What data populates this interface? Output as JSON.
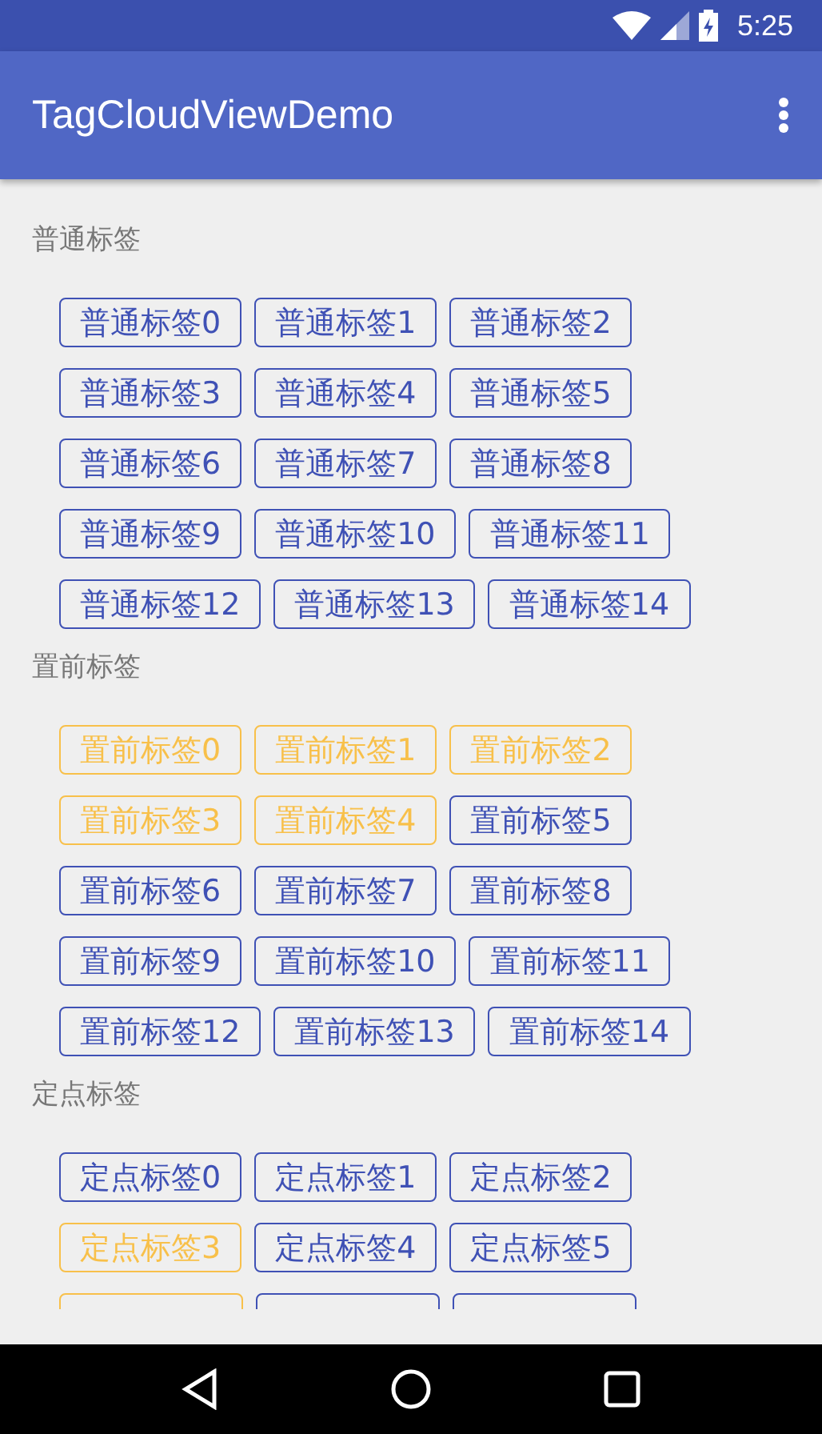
{
  "status_bar": {
    "time": "5:25"
  },
  "app_bar": {
    "title": "TagCloudViewDemo"
  },
  "sections": [
    {
      "title": "普通标签",
      "tags": [
        {
          "label": "普通标签0",
          "selected": false
        },
        {
          "label": "普通标签1",
          "selected": false
        },
        {
          "label": "普通标签2",
          "selected": false
        },
        {
          "label": "普通标签3",
          "selected": false
        },
        {
          "label": "普通标签4",
          "selected": false
        },
        {
          "label": "普通标签5",
          "selected": false
        },
        {
          "label": "普通标签6",
          "selected": false
        },
        {
          "label": "普通标签7",
          "selected": false
        },
        {
          "label": "普通标签8",
          "selected": false
        },
        {
          "label": "普通标签9",
          "selected": false
        },
        {
          "label": "普通标签10",
          "selected": false
        },
        {
          "label": "普通标签11",
          "selected": false
        },
        {
          "label": "普通标签12",
          "selected": false
        },
        {
          "label": "普通标签13",
          "selected": false
        },
        {
          "label": "普通标签14",
          "selected": false
        }
      ]
    },
    {
      "title": "置前标签",
      "tags": [
        {
          "label": "置前标签0",
          "selected": true
        },
        {
          "label": "置前标签1",
          "selected": true
        },
        {
          "label": "置前标签2",
          "selected": true
        },
        {
          "label": "置前标签3",
          "selected": true
        },
        {
          "label": "置前标签4",
          "selected": true
        },
        {
          "label": "置前标签5",
          "selected": false
        },
        {
          "label": "置前标签6",
          "selected": false
        },
        {
          "label": "置前标签7",
          "selected": false
        },
        {
          "label": "置前标签8",
          "selected": false
        },
        {
          "label": "置前标签9",
          "selected": false
        },
        {
          "label": "置前标签10",
          "selected": false
        },
        {
          "label": "置前标签11",
          "selected": false
        },
        {
          "label": "置前标签12",
          "selected": false
        },
        {
          "label": "置前标签13",
          "selected": false
        },
        {
          "label": "置前标签14",
          "selected": false
        }
      ]
    },
    {
      "title": "定点标签",
      "tags": [
        {
          "label": "定点标签0",
          "selected": false
        },
        {
          "label": "定点标签1",
          "selected": false
        },
        {
          "label": "定点标签2",
          "selected": false
        },
        {
          "label": "定点标签3",
          "selected": true
        },
        {
          "label": "定点标签4",
          "selected": false
        },
        {
          "label": "定点标签5",
          "selected": false
        },
        {
          "selected": true
        },
        {
          "selected": false
        },
        {
          "selected": false
        }
      ]
    }
  ]
}
